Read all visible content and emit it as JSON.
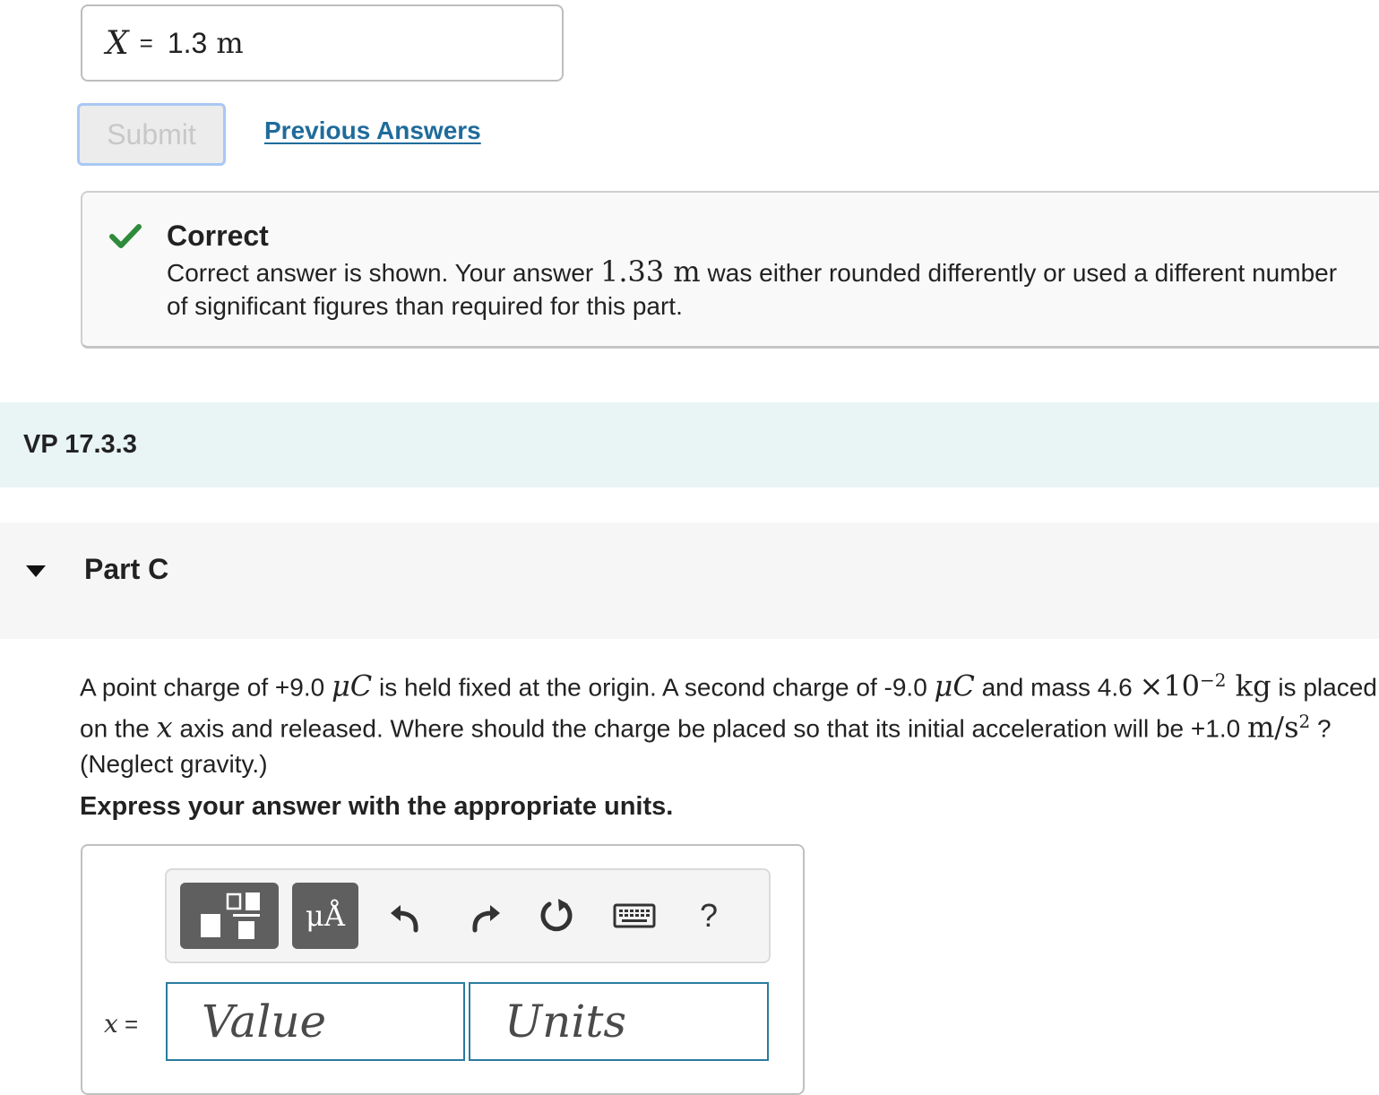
{
  "previous_answer": {
    "variable": "X",
    "equals": "=",
    "value": "1.3",
    "unit": "m"
  },
  "actions": {
    "submit_label": "Submit",
    "previous_answers_label": "Previous Answers"
  },
  "feedback": {
    "title": "Correct",
    "text_before": "Correct answer is shown. Your answer ",
    "answer": "1.33 m",
    "text_after": " was either rounded differently or used a different number of significant figures than required for this part.",
    "status_color": "#2e8b3a"
  },
  "section": {
    "title": "VP 17.3.3"
  },
  "part": {
    "title": "Part C"
  },
  "question": {
    "t1": "A point charge of +9.0 ",
    "u1": "μC",
    "t2": " is held fixed at the origin. A second charge of -9.0 ",
    "u2": "μC",
    "t3": " and mass 4.6 ",
    "times": "×10",
    "exp": "−2",
    "u3": " kg",
    "t4": " is placed on the ",
    "axis": "x",
    "t5": " axis and released. Where should the charge be placed so that its initial acceleration will be +1.0 ",
    "u4": "m/s",
    "u4_exp": "2",
    "t6": " ? (Neglect gravity.)"
  },
  "instruction": "Express your answer with the appropriate units.",
  "toolbar": {
    "templates_icon": "templates-icon",
    "units_label": "μÅ",
    "undo_icon": "undo-icon",
    "redo_icon": "redo-icon",
    "reset_icon": "reset-icon",
    "keyboard_icon": "keyboard-icon",
    "help_label": "?"
  },
  "answer": {
    "variable": "x",
    "equals": "=",
    "value_placeholder": "Value",
    "units_placeholder": "Units"
  }
}
